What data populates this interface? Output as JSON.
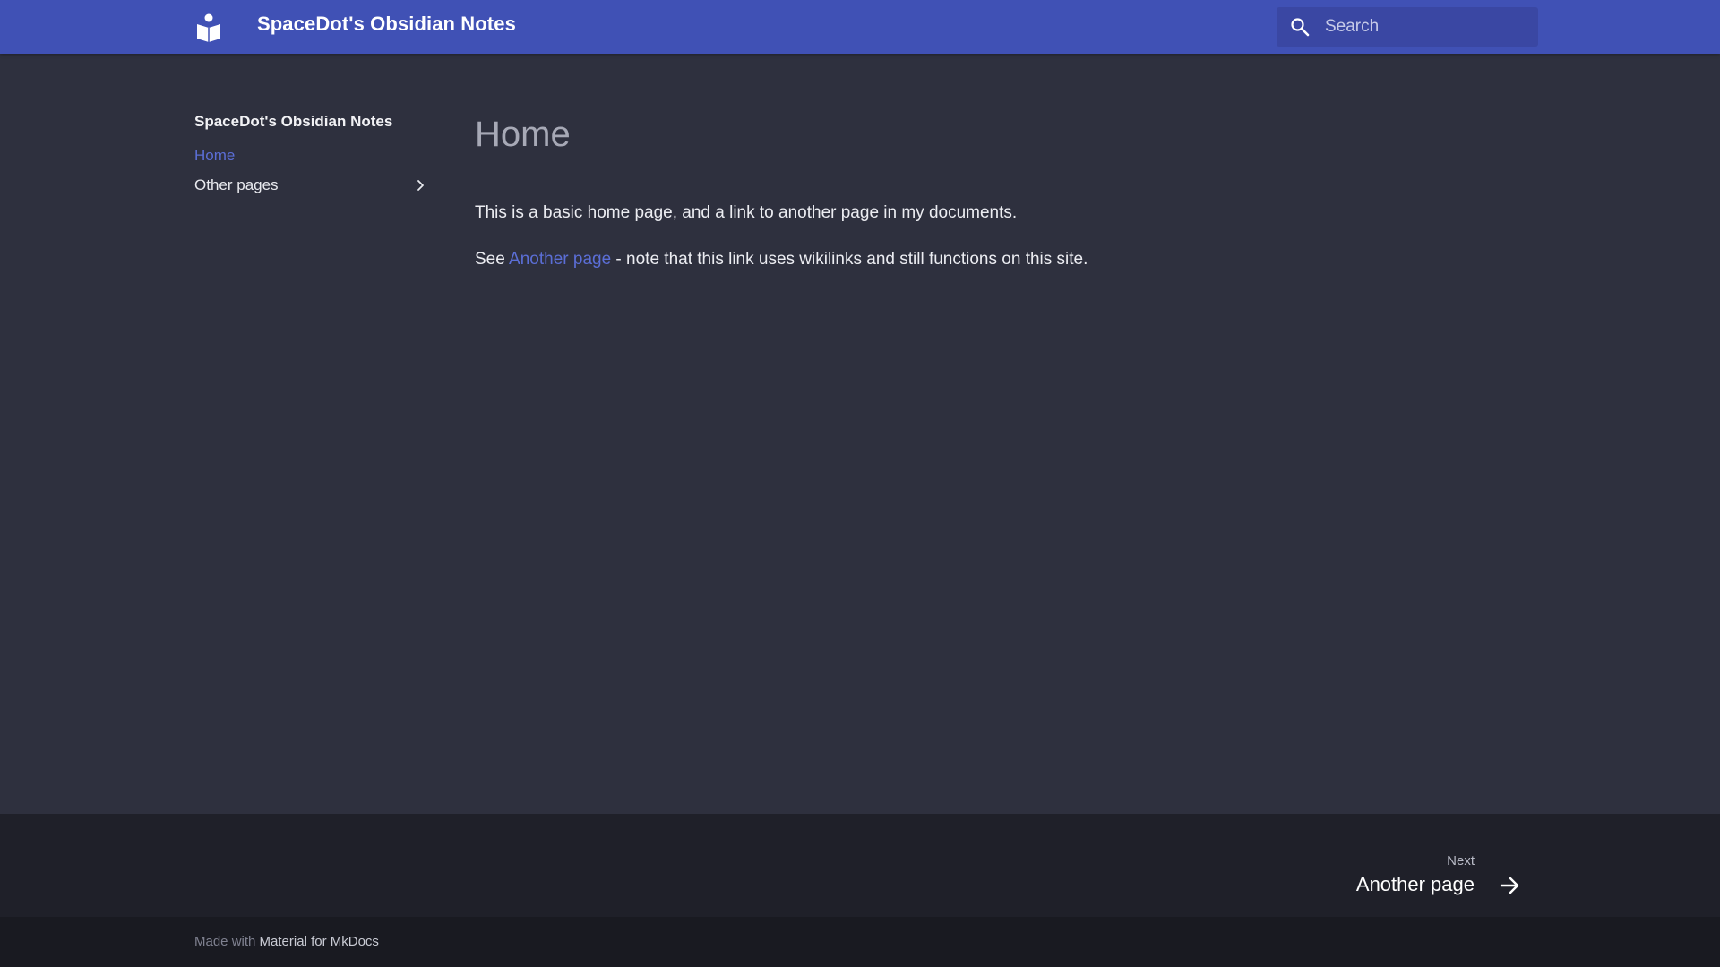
{
  "header": {
    "site_title": "SpaceDot's Obsidian Notes",
    "logo_icon": "book-reader-icon",
    "search": {
      "placeholder": "Search",
      "value": ""
    }
  },
  "sidebar": {
    "title": "SpaceDot's Obsidian Notes",
    "items": [
      {
        "label": "Home",
        "active": true
      },
      {
        "label": "Other pages",
        "expandable": true,
        "icon": "chevron-right-icon"
      }
    ]
  },
  "main": {
    "title": "Home",
    "paragraph1": "This is a basic home page, and a link to another page in my documents.",
    "paragraph2": {
      "prefix": "See ",
      "link_text": "Another page",
      "suffix": " - note that this link uses wikilinks and still functions on this site."
    }
  },
  "footer_nav": {
    "next_label": "Next",
    "next_title": "Another page",
    "arrow_icon": "arrow-right-icon"
  },
  "footer_meta": {
    "made_with": "Made with",
    "generator_link": "Material for MkDocs"
  },
  "colors": {
    "header_bg": "#4051b5",
    "body_bg": "#2e303e",
    "accent": "#5b6ed6",
    "footer_nav_bg": "#1f2029",
    "footer_meta_bg": "#191a21"
  }
}
